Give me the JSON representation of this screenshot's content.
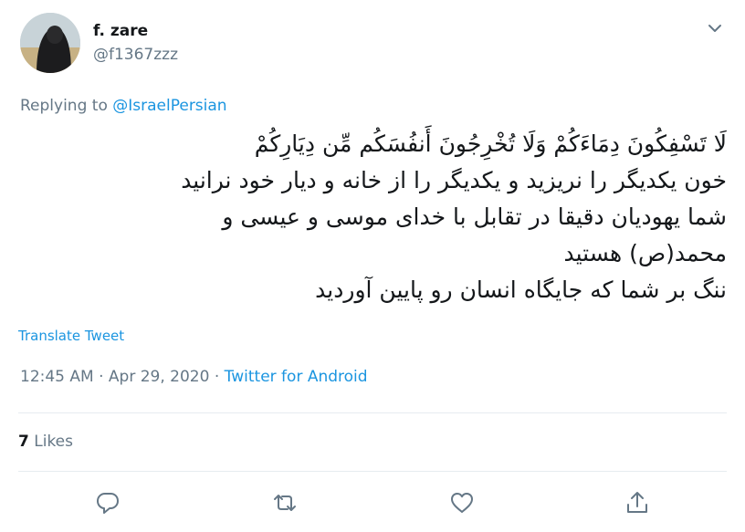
{
  "tweet": {
    "author_name": "f. zare",
    "author_handle": "@f1367zzz",
    "replying_prefix": "Replying to",
    "replying_to": "@IsraelPersian",
    "text_lines": [
      "لَا تَسْفِكُونَ دِمَاءَكُمْ وَلَا تُخْرِجُونَ أَنفُسَكُم مِّن دِيَارِكُمْ",
      "خون یکدیگر را نریزید و یکدیگر را از خانه و دیار خود نرانید",
      "شما یهودیان دقیقا در تقابل با خدای موسی و عیسی و",
      "محمد(ص) هستید",
      "ننگ بر شما که جایگاه انسان رو پایین آوردید"
    ],
    "translate_label": "Translate Tweet",
    "time": "12:45 AM",
    "separator": "·",
    "date": "Apr 29, 2020",
    "source": "Twitter for Android",
    "likes_count": "7",
    "likes_label": "Likes"
  },
  "icons": {
    "more": "chevron-down-icon",
    "reply": "reply-icon",
    "retweet": "retweet-icon",
    "like": "heart-icon",
    "share": "share-icon"
  },
  "colors": {
    "link": "#1b95e0",
    "secondary_text": "#657786",
    "primary_text": "#14171a",
    "divider": "#e6ecf0"
  }
}
